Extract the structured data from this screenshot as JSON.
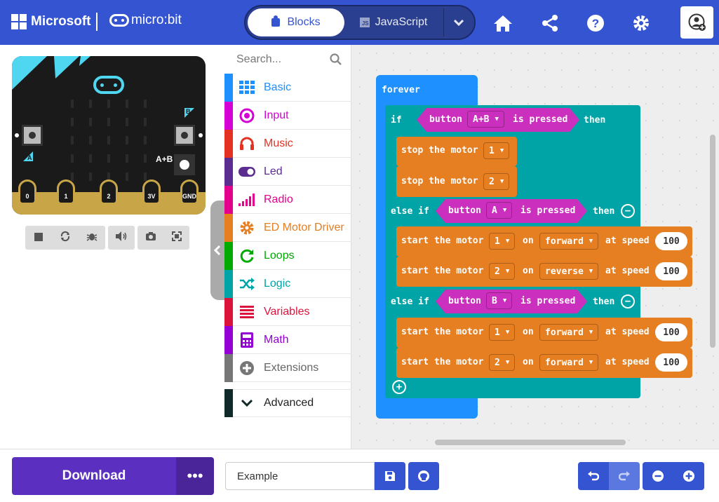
{
  "header": {
    "ms_label": "Microsoft",
    "mb_label": "micro:bit",
    "tabs": {
      "blocks": "Blocks",
      "javascript": "JavaScript",
      "js_badge": "JS"
    },
    "icons": [
      "home-icon",
      "share-icon",
      "help-icon",
      "settings-icon",
      "account-icon"
    ],
    "accent": "#3454d1"
  },
  "simulator": {
    "pins": [
      "0",
      "1",
      "2",
      "3V",
      "GND"
    ],
    "button_a": "A",
    "button_b": "B",
    "button_ab": "A+B",
    "controls": [
      "stop-icon",
      "restart-icon",
      "debug-icon",
      "sound-icon",
      "screenshot-icon",
      "fullscreen-icon"
    ]
  },
  "toolbox": {
    "search_placeholder": "Search...",
    "categories": [
      {
        "label": "Basic",
        "color": "#1e90ff"
      },
      {
        "label": "Input",
        "color": "#d400d4"
      },
      {
        "label": "Music",
        "color": "#e63022"
      },
      {
        "label": "Led",
        "color": "#5c2d91"
      },
      {
        "label": "Radio",
        "color": "#e3008c"
      },
      {
        "label": "ED Motor Driver",
        "color": "#e67e22"
      },
      {
        "label": "Loops",
        "color": "#00aa00"
      },
      {
        "label": "Logic",
        "color": "#00a4a6"
      },
      {
        "label": "Variables",
        "color": "#dc143c"
      },
      {
        "label": "Math",
        "color": "#9400d3"
      },
      {
        "label": "Extensions",
        "color": "#777777"
      },
      {
        "label": "Advanced",
        "color": "#102a2a"
      }
    ]
  },
  "blocks": {
    "forever": "forever",
    "if": "if",
    "else_if": "else if",
    "then": "then",
    "button": "button",
    "is_pressed": "is pressed",
    "stop_the_motor": "stop the motor",
    "start_the_motor": "start the motor",
    "on": "on",
    "at_speed": "at speed",
    "cond1_button": "A+B",
    "cond2_button": "A",
    "cond3_button": "B",
    "stop1": "1",
    "stop2": "2",
    "s1": {
      "motor": "1",
      "dir": "forward",
      "speed": "100"
    },
    "s2": {
      "motor": "2",
      "dir": "reverse",
      "speed": "100"
    },
    "s3": {
      "motor": "1",
      "dir": "forward",
      "speed": "100"
    },
    "s4": {
      "motor": "2",
      "dir": "forward",
      "speed": "100"
    }
  },
  "footer": {
    "download": "Download",
    "more": "•••",
    "project_name": "Example"
  }
}
